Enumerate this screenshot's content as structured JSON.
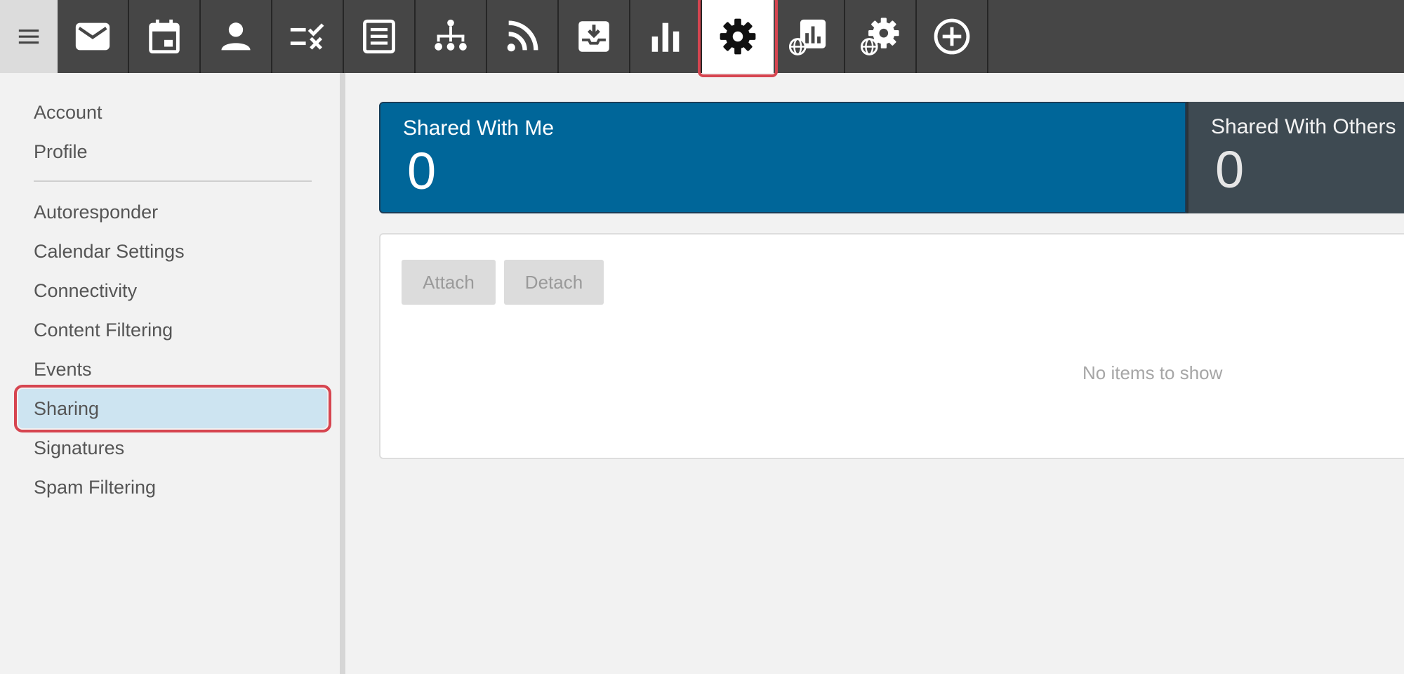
{
  "toolbar": {
    "menu_icon": "hamburger-menu-icon",
    "tools": [
      {
        "name": "mail-icon",
        "active": false
      },
      {
        "name": "calendar-icon",
        "active": false
      },
      {
        "name": "contacts-icon",
        "active": false
      },
      {
        "name": "tasks-icon",
        "active": false
      },
      {
        "name": "notes-icon",
        "active": false
      },
      {
        "name": "organization-icon",
        "active": false
      },
      {
        "name": "rss-icon",
        "active": false
      },
      {
        "name": "archive-inbox-icon",
        "active": false
      },
      {
        "name": "reports-icon",
        "active": false
      },
      {
        "name": "settings-gear-icon",
        "active": true
      },
      {
        "name": "domain-reports-icon",
        "active": false
      },
      {
        "name": "domain-settings-icon",
        "active": false
      },
      {
        "name": "add-circle-icon",
        "active": false
      }
    ]
  },
  "sidebar": {
    "group1": [
      "Account",
      "Profile"
    ],
    "group2": [
      "Autoresponder",
      "Calendar Settings",
      "Connectivity",
      "Content Filtering",
      "Events",
      "Sharing",
      "Signatures",
      "Spam Filtering"
    ],
    "selected": "Sharing"
  },
  "stats": {
    "shared_with_me": {
      "label": "Shared With Me",
      "value": "0"
    },
    "shared_with_others": {
      "label": "Shared With Others",
      "value": "0"
    }
  },
  "panel": {
    "attach_label": "Attach",
    "detach_label": "Detach",
    "empty_text": "No items to show"
  },
  "colors": {
    "toolbar_bg": "#464646",
    "accent_blue": "#006699",
    "selected_item_bg": "#cde4f1",
    "highlight_red": "#d64550"
  }
}
